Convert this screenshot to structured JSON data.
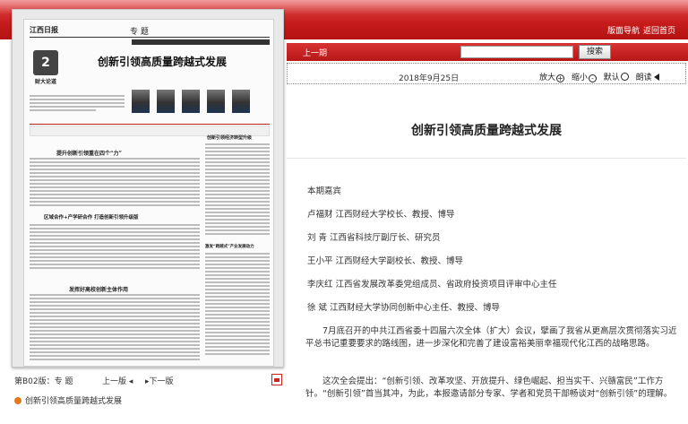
{
  "top_nav": {
    "layout_nav": "版面导航",
    "back_home": "返回首页"
  },
  "newspaper": {
    "masthead": "江西日报",
    "section": "专 题",
    "column_number": "2",
    "column_name": "财大论道",
    "headline": "创新引领高质量跨越式发展",
    "sub_titles": [
      "提升创新引领重在四个“力”",
      "区域合作+产学研合作 打造创新引领升级版",
      "发挥好高校创新主体作用",
      "创新引领经济转型升级",
      "激发“跨越式”产业发展动力"
    ]
  },
  "page_info": {
    "page_label": "第B02版：专 题",
    "prev_page": "上一版",
    "next_page": "下一版",
    "article_link": "创新引领高质量跨越式发展"
  },
  "reader": {
    "prev_issue": "上一期",
    "search_button": "搜索",
    "date": "2018年9月25日",
    "zoom_in": "放大",
    "zoom_out": "缩小",
    "default": "默认",
    "read_aloud": "朗读"
  },
  "article": {
    "title": "创新引领高质量跨越式发展",
    "paragraphs": [
      "本期嘉宾",
      "卢福财 江西财经大学校长、教授、博导",
      "刘 青 江西省科技厅副厅长、研究员",
      "王小平 江西财经大学副校长、教授、博导",
      "李庆红 江西省发展改革委党组成员、省政府投资项目评审中心主任",
      "徐 斌 江西财经大学协同创新中心主任、教授、博导",
      "7月底召开的中共江西省委十四届六次全体（扩大）会议，擘画了我省从更高层次贯彻落实习近平总书记重要要求的路线图，进一步深化和完善了建设富裕美丽幸福现代化江西的战略思路。",
      "这次全会提出：“创新引领、改革攻坚、开放提升、绿色崛起、担当实干、兴赣富民”工作方针。“创新引领”首当其冲，为此，本报邀请部分专家、学者和党员干部畅谈对“创新引领”的理解。"
    ]
  },
  "colors": {
    "banner_red": "#c51b1b",
    "bullet_orange": "#e07a1c"
  },
  "icons": [
    "plus-circle-icon",
    "minus-circle-icon",
    "circle-icon",
    "speaker-icon",
    "pdf-icon",
    "triangle-left-icon",
    "triangle-right-icon",
    "bullet-icon"
  ]
}
